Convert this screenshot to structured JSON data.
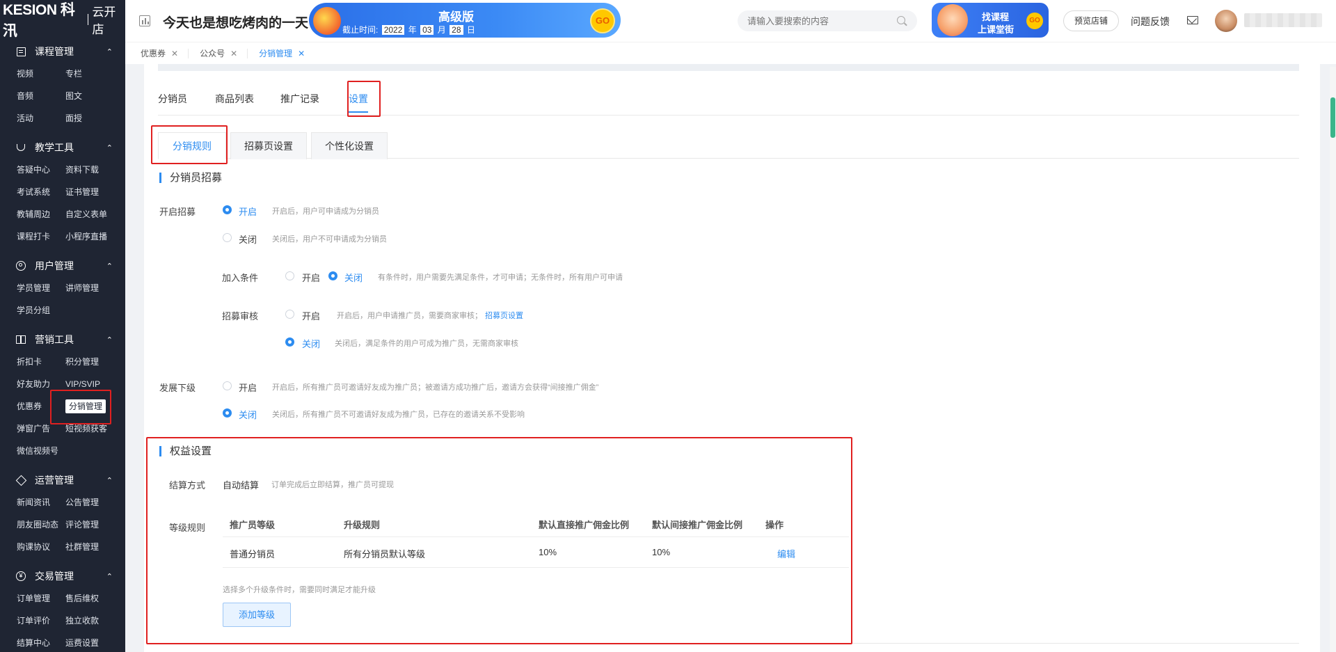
{
  "sidebar": {
    "logo_brand": "KESION 科汛",
    "logo_sub": "云开店",
    "groups": [
      {
        "title": "课程管理",
        "icon": "book-icon",
        "items": [
          "视频",
          "专栏",
          "音频",
          "图文",
          "活动",
          "面授"
        ]
      },
      {
        "title": "教学工具",
        "icon": "trophy-icon",
        "items": [
          "答疑中心",
          "资料下载",
          "考试系统",
          "证书管理",
          "教辅周边",
          "自定义表单",
          "课程打卡",
          "小程序直播"
        ]
      },
      {
        "title": "用户管理",
        "icon": "user-icon",
        "items": [
          "学员管理",
          "讲师管理",
          "学员分组"
        ]
      },
      {
        "title": "营销工具",
        "icon": "gift-icon",
        "items": [
          "折扣卡",
          "积分管理",
          "好友助力",
          "VIP/SVIP",
          "优惠券",
          "分销管理",
          "弹窗广告",
          "短视频获客",
          "微信视频号"
        ]
      },
      {
        "title": "运营管理",
        "icon": "layers-icon",
        "items": [
          "新闻资讯",
          "公告管理",
          "朋友圈动态",
          "评论管理",
          "购课协议",
          "社群管理"
        ]
      },
      {
        "title": "交易管理",
        "icon": "yen-icon",
        "items": [
          "订单管理",
          "售后维权",
          "订单评价",
          "独立收款",
          "结算中心",
          "运费设置"
        ]
      }
    ],
    "active_item": "分销管理"
  },
  "topbar": {
    "shop_name": "今天也是想吃烤肉的一天",
    "banner_title": "高级版",
    "banner_expiry_label": "截止时间:",
    "banner_year": "2022",
    "banner_year_unit": "年",
    "banner_month": "03",
    "banner_month_unit": "月",
    "banner_day": "28",
    "banner_day_unit": "日",
    "banner_go": "GO",
    "search_placeholder": "请输入要搜索的内容",
    "promo_line1": "找课程",
    "promo_line2": "上课堂街",
    "promo_go": "GO",
    "preview_button": "预览店铺",
    "feedback": "问题反馈"
  },
  "open_tabs": [
    {
      "label": "优惠券",
      "active": false
    },
    {
      "label": "公众号",
      "active": false
    },
    {
      "label": "分销管理",
      "active": true
    }
  ],
  "main_tabs": [
    "分销员",
    "商品列表",
    "推广记录",
    "设置"
  ],
  "active_main_tab": "设置",
  "sub_tabs": [
    "分销规则",
    "招募页设置",
    "个性化设置"
  ],
  "active_sub_tab": "分销规则",
  "recruit": {
    "section_title": "分销员招募",
    "open_label": "开启招募",
    "open_on": "开启",
    "open_on_hint": "开启后，用户可申请成为分销员",
    "open_off": "关闭",
    "open_off_hint": "关闭后，用户不可申请成为分销员",
    "cond_label": "加入条件",
    "cond_on": "开启",
    "cond_off": "关闭",
    "cond_hint": "有条件时，用户需要先满足条件，才可申请；无条件时，所有用户可申请",
    "audit_label": "招募审核",
    "audit_on": "开启",
    "audit_on_hint": "开启后，用户申请推广员，需要商家审核；",
    "audit_link": "招募页设置",
    "audit_off": "关闭",
    "audit_off_hint": "关闭后，满足条件的用户可成为推广员，无需商家审核",
    "sub_label": "发展下级",
    "sub_on": "开启",
    "sub_on_hint": "开启后，所有推广员可邀请好友成为推广员；被邀请方成功推广后，邀请方会获得“间接推广佣金”",
    "sub_off": "关闭",
    "sub_off_hint": "关闭后，所有推广员不可邀请好友成为推广员，已存在的邀请关系不受影响"
  },
  "rights": {
    "section_title": "权益设置",
    "settle_label": "结算方式",
    "settle_value": "自动结算",
    "settle_hint": "订单完成后立即结算，推广员可提现",
    "level_label": "等级规则",
    "columns": [
      "推广员等级",
      "升级规则",
      "默认直接推广佣金比例",
      "默认间接推广佣金比例",
      "操作"
    ],
    "rows": [
      {
        "level": "普通分销员",
        "rule": "所有分销员默认等级",
        "direct": "10%",
        "indirect": "10%",
        "action": "编辑"
      }
    ],
    "note": "选择多个升级条件时，需要同时满足才能升级",
    "add_button": "添加等级"
  },
  "colors": {
    "sidebar_bg": "#1f2533",
    "accent": "#2d8cf0",
    "highlight_box": "#e02020"
  }
}
